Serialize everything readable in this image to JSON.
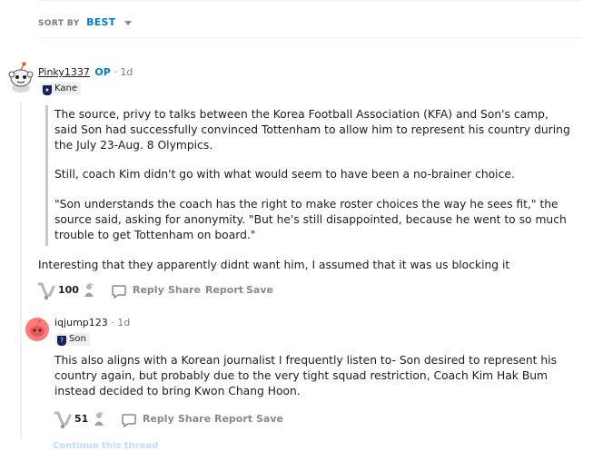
{
  "sort": {
    "label": "SORT BY",
    "value": "BEST"
  },
  "comments": [
    {
      "username": "Pinky1337",
      "op_badge": "OP",
      "separator": "·",
      "time": "1d",
      "flair": "Kane",
      "flair_badge": "★",
      "quote": [
        "The source, privy to talks between the Korea Football Association (KFA) and Son's camp, said Son had successfully convinced Tottenham to allow him to represent his country during the July 23-Aug. 8 Olympics.",
        "Still, coach Kim didn't go with what would seem to have been a no-brainer choice.",
        "\"Son understands the coach has the right to make roster choices the way he sees fit,\" the source said, asking for anonymity. \"But he's still disappointed, because he went to so much trouble to get Tottenham on board.\""
      ],
      "body": "Interesting that they apparently didnt want him, I assumed that it was us blocking it",
      "score": "100",
      "actions": {
        "reply": "Reply",
        "share": "Share",
        "report": "Report",
        "save": "Save"
      }
    },
    {
      "username": "iqjump123",
      "separator": "·",
      "time": "1d",
      "flair": "Son",
      "flair_badge": "7",
      "body": "This also aligns with a Korean journalist I frequently listen to- Son desired to represent his country again, but probably due to the very tight squad restriction, Coach Kim Hak Bum instead decided to bring Kwon Chang Hoon.",
      "score": "51",
      "actions": {
        "reply": "Reply",
        "share": "Share",
        "report": "Report",
        "save": "Save"
      }
    }
  ],
  "continue_thread": "Continue this thread",
  "colors": {
    "accent": "#0079d3",
    "muted": "#878a8c",
    "text": "#1c1c1c",
    "flair_bg": "#edeff1",
    "spurs_navy": "#132257"
  }
}
